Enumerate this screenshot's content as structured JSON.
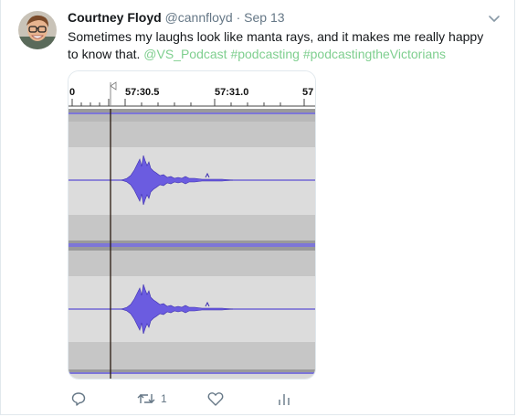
{
  "tweet": {
    "name": "Courtney Floyd",
    "handle": "@cannfloyd",
    "separator": "·",
    "time": "Sep 13",
    "text_main": "Sometimes my laughs look like manta rays, and it makes me really happy to know that.",
    "mention": "@VS_Podcast",
    "hashtag1": "#podcasting",
    "hashtag2": "#podcastingtheVictorians",
    "retweet_count": "1"
  },
  "ruler": {
    "tick0": "0",
    "tick1": "57:30.5",
    "tick2": "57:31.0",
    "tick3": "57"
  },
  "colors": {
    "link": "#7fcf8f",
    "waveform": "#5b4fd1",
    "track_bg": "#c8c8c8",
    "text": "#14171a",
    "muted": "#657786"
  },
  "icons": [
    "chevron-down-icon",
    "reply-icon",
    "retweet-icon",
    "like-icon",
    "analytics-icon"
  ]
}
